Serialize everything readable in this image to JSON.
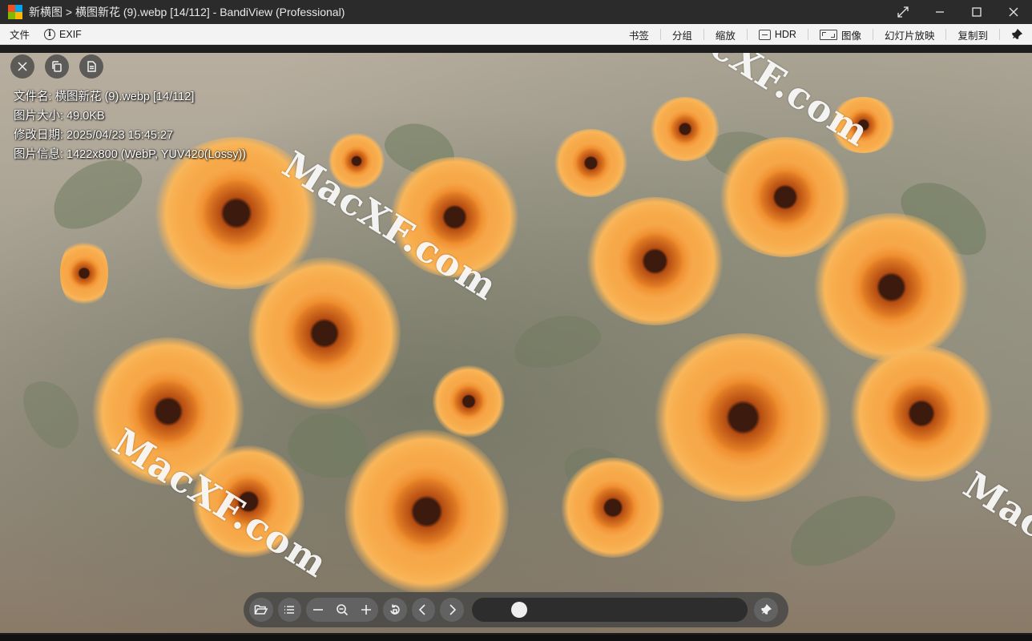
{
  "window": {
    "title": "新横图 > 横图新花 (9).webp [14/112] - BandiView (Professional)",
    "logo_colors": [
      "#f25022",
      "#7fba00",
      "#00a4ef",
      "#ffb900"
    ],
    "buttons": [
      "expand-icon",
      "minimize-icon",
      "maximize-icon",
      "close-icon"
    ]
  },
  "menu": {
    "left": [
      {
        "label": "文件"
      },
      {
        "label": "EXIF",
        "icon": "info-icon"
      }
    ],
    "right": [
      {
        "label": "书签"
      },
      {
        "label": "分组"
      },
      {
        "label": "缩放"
      },
      {
        "label": "HDR",
        "icon": "hdr-icon"
      },
      {
        "label": "图像",
        "icon": "image-fit-icon"
      },
      {
        "label": "幻灯片放映"
      },
      {
        "label": "复制到"
      }
    ],
    "pin_icon": "pin-icon"
  },
  "overlay": {
    "top_buttons": [
      "close-icon",
      "copy-icon",
      "document-icon"
    ],
    "info": {
      "filename": "文件名: 横图新花 (9).webp [14/112]",
      "filesize": "图片大小: 49.0KB",
      "modified": "修改日期: 2025/04/23 15:45:27",
      "details": "图片信息: 1422x800 (WebP, YUV420(Lossy))"
    }
  },
  "image": {
    "description_colors": {
      "petal": "#f39a33",
      "center": "#3d1a0e",
      "background": "#a7a192",
      "leaf": "#6f7b5e"
    },
    "watermark": "MacXF.com"
  },
  "toolbar": {
    "buttons": [
      "folder-icon",
      "list-icon",
      "zoom-out-minus-icon",
      "zoom-icon",
      "zoom-in-plus-icon",
      "rotate-icon",
      "prev-icon",
      "next-icon",
      "pin-icon"
    ],
    "slider_position": 0.14
  }
}
